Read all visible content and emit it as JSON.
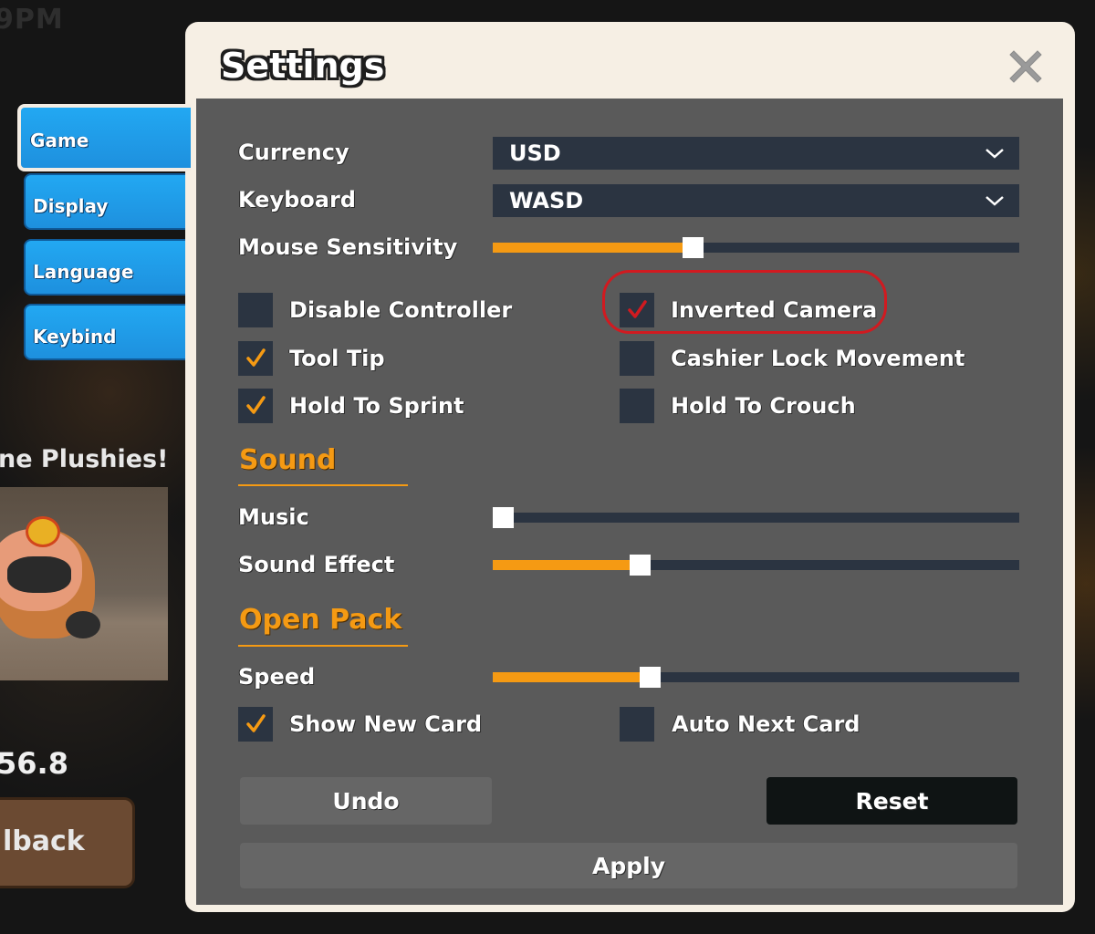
{
  "background": {
    "time_text": "9PM",
    "plush_title": "ne Plushies!",
    "amount": "56.8",
    "feedback_label": "lback"
  },
  "tabs": [
    {
      "label": "Game",
      "active": true
    },
    {
      "label": "Display",
      "active": false
    },
    {
      "label": "Language",
      "active": false
    },
    {
      "label": "Keybind",
      "active": false
    }
  ],
  "modal": {
    "title": "Settings",
    "close_icon": "close-icon"
  },
  "game": {
    "currency": {
      "label": "Currency",
      "value": "USD"
    },
    "keyboard": {
      "label": "Keyboard",
      "value": "WASD"
    },
    "mouse_sensitivity": {
      "label": "Mouse Sensitivity",
      "level": 0.375
    },
    "checkboxes": [
      {
        "label": "Disable Controller",
        "checked": false
      },
      {
        "label": "Inverted Camera",
        "checked": true
      },
      {
        "label": "Tool Tip",
        "checked": true
      },
      {
        "label": "Cashier Lock Movement",
        "checked": false
      },
      {
        "label": "Hold To Sprint",
        "checked": true
      },
      {
        "label": "Hold To Crouch",
        "checked": false
      }
    ]
  },
  "sound": {
    "title": "Sound",
    "music": {
      "label": "Music",
      "level": 0.0
    },
    "sound_effect": {
      "label": "Sound Effect",
      "level": 0.27
    }
  },
  "open_pack": {
    "title": "Open Pack",
    "speed": {
      "label": "Speed",
      "level": 0.29
    },
    "checkboxes": [
      {
        "label": "Show New Card",
        "checked": true
      },
      {
        "label": "Auto Next Card",
        "checked": false
      }
    ]
  },
  "buttons": {
    "undo": "Undo",
    "reset": "Reset",
    "apply": "Apply"
  },
  "colors": {
    "accent": "#f59a13",
    "panel": "#5a5a5a",
    "control": "#2b3441",
    "tab": "#1e90de",
    "annotation": "#d11a20"
  }
}
